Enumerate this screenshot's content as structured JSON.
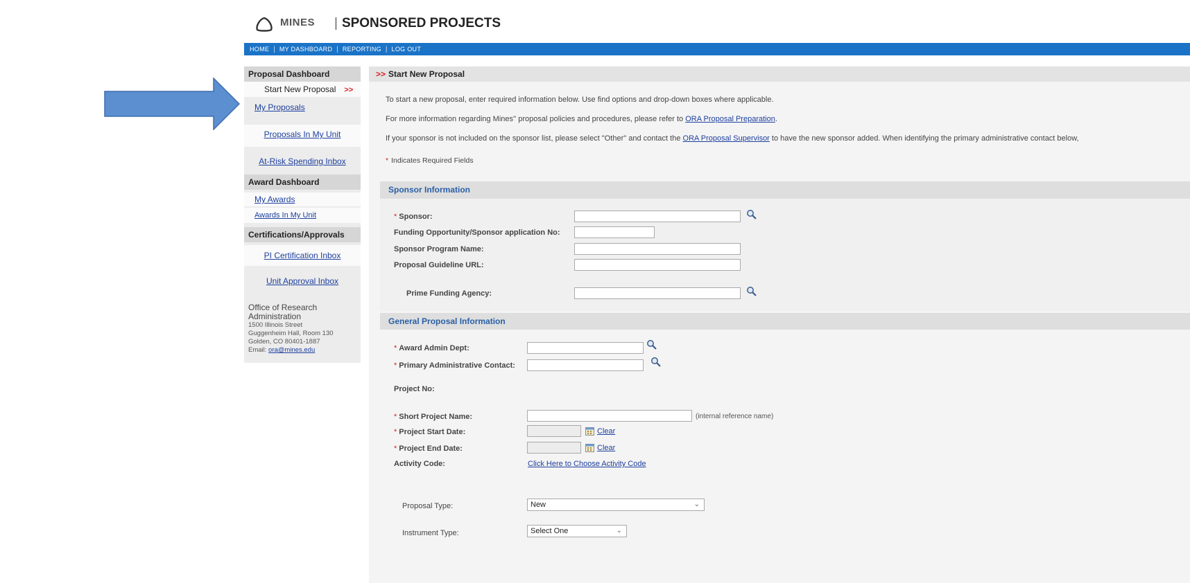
{
  "header": {
    "brand": "MINES",
    "pipe": "|",
    "title": "SPONSORED PROJECTS"
  },
  "topnav": {
    "items": [
      "HOME",
      "MY DASHBOARD",
      "REPORTING",
      "LOG OUT"
    ],
    "separator": "|",
    "color": "#1a73c7"
  },
  "sidebar": {
    "proposal_header": "Proposal Dashboard",
    "start_new": "Start New Proposal",
    "current_marker": ">>",
    "my_proposals": "My Proposals",
    "proposals_in_unit": "Proposals In My Unit",
    "at_risk": "At-Risk Spending Inbox",
    "award_header": "Award Dashboard",
    "my_awards": "My Awards",
    "awards_in_unit": "Awards In My Unit",
    "cert_header": "Certifications/Approvals",
    "pi_cert": "PI Certification Inbox",
    "unit_approval": "Unit Approval Inbox",
    "office_line1": "Office of Research",
    "office_line2": "Administration",
    "address1": "1500 Illinois Street",
    "address2": "Guggenheim Hall, Room 130",
    "address3": "Golden, CO 80401-1887",
    "email_label": "Email:",
    "email": "ora@mines.edu"
  },
  "main": {
    "header_marker": ">>",
    "header": "Start New Proposal",
    "intro1": "To start a new proposal, enter required information below. Use find options and drop-down boxes where applicable.",
    "intro2_pre": "For more information regarding Mines'' proposal policies and procedures, please refer to",
    "intro2_link": "ORA Proposal Preparation",
    "intro2_post": ".",
    "intro3_pre": "If your sponsor is not included on the sponsor list, please select \"Other\" and contact the",
    "intro3_link": "ORA Proposal Supervisor",
    "intro3_post": "to have the new sponsor added. When identifying the primary administrative contact below,",
    "required_star": "*",
    "required_note": "Indicates Required Fields"
  },
  "sponsor_section": {
    "title": "Sponsor Information",
    "sponsor_label": "Sponsor:",
    "sponsor_value": "",
    "funding_label": "Funding Opportunity/Sponsor application No:",
    "funding_value": "",
    "program_label": "Sponsor Program Name:",
    "program_value": "",
    "guideline_label": "Proposal Guideline URL:",
    "guideline_value": "",
    "prime_label": "Prime Funding Agency:",
    "prime_value": ""
  },
  "general_section": {
    "title": "General Proposal Information",
    "admin_dept_label": "Award Admin Dept:",
    "admin_dept_value": "",
    "primary_contact_label": "Primary Administrative Contact:",
    "primary_contact_value": "",
    "project_no_label": "Project No:",
    "short_name_label": "Short Project Name:",
    "short_name_value": "",
    "short_name_hint": "(internal reference name)",
    "start_date_label": "Project Start Date:",
    "start_date_value": "",
    "end_date_label": "Project End Date:",
    "end_date_value": "",
    "clear_label": "Clear",
    "activity_label": "Activity Code:",
    "activity_link": "Click Here to Choose Activity Code",
    "proposal_type_label": "Proposal Type:",
    "proposal_type_value": "New",
    "instrument_type_label": "Instrument Type:",
    "instrument_type_value": "Select One"
  }
}
